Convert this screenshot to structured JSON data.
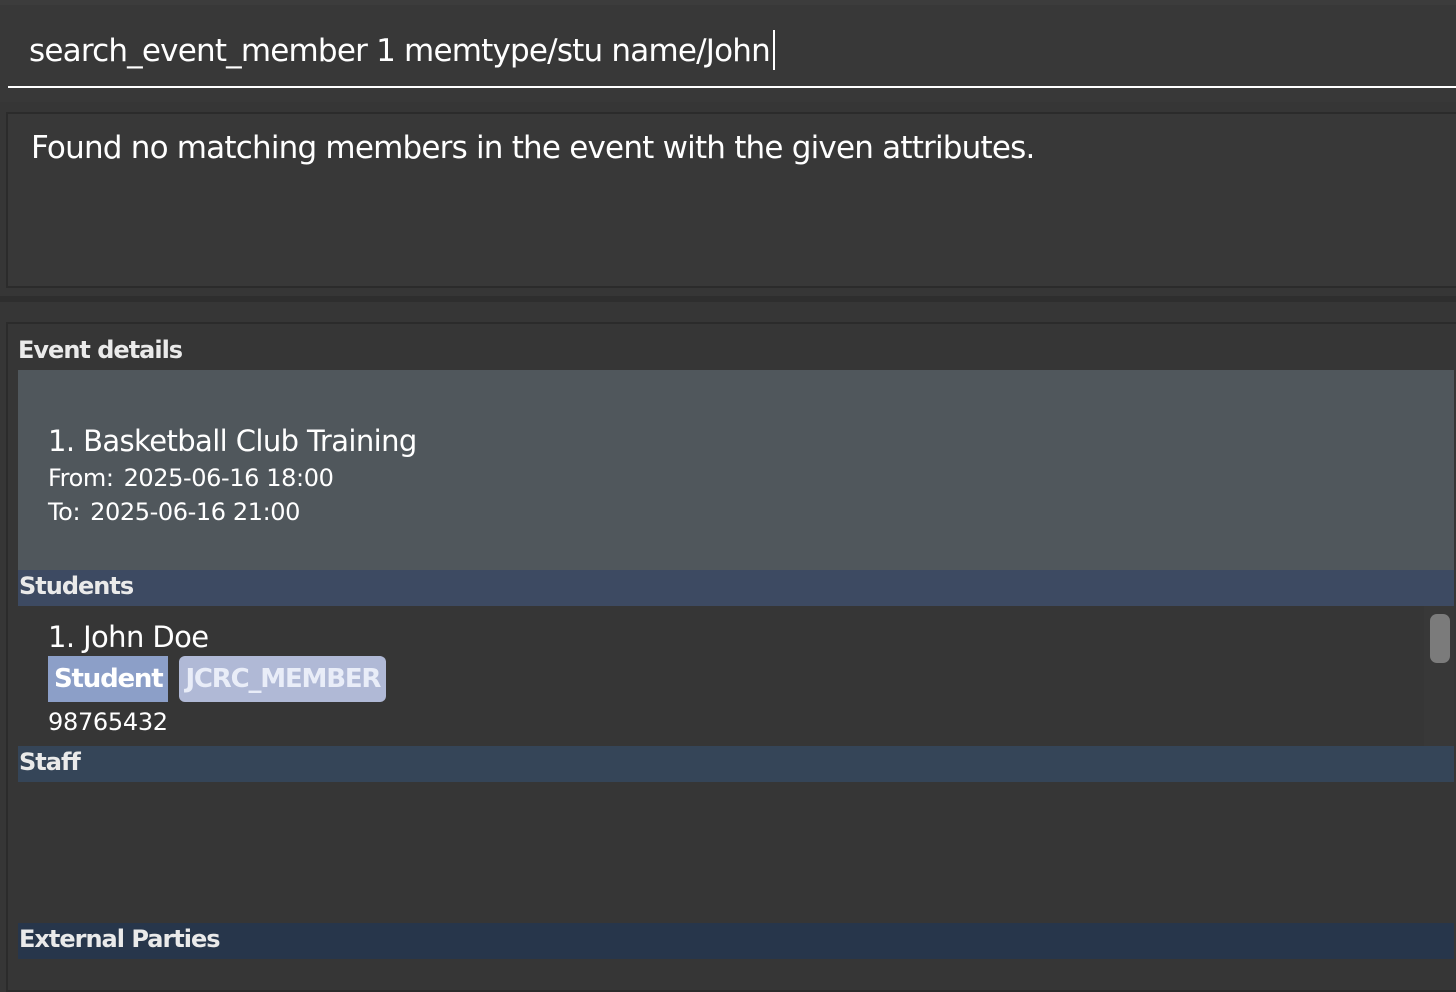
{
  "command": {
    "value": "search_event_member 1 memtype/stu name/John"
  },
  "result": {
    "message": "Found no matching members in the event with the given attributes."
  },
  "event_details": {
    "title": "Event details",
    "event": {
      "name": "1. Basketball Club Training",
      "from_label": "From:",
      "from_value": "2025-06-16 18:00",
      "to_label": "To:",
      "to_value": "2025-06-16 21:00"
    }
  },
  "students": {
    "title": "Students",
    "members": [
      {
        "name": "1. John Doe",
        "tags": [
          "Student",
          "JCRC_MEMBER"
        ],
        "phone": "98765432"
      }
    ]
  },
  "staff": {
    "title": "Staff"
  },
  "external_parties": {
    "title": "External Parties"
  },
  "colors": {
    "background": "#363636",
    "event_card": "#50575c",
    "students_header": "#3d4a62",
    "staff_header": "#354558",
    "external_header": "#27364b",
    "tag_student": "#8c9fc8",
    "tag_jcrc": "#b0b9d6"
  }
}
